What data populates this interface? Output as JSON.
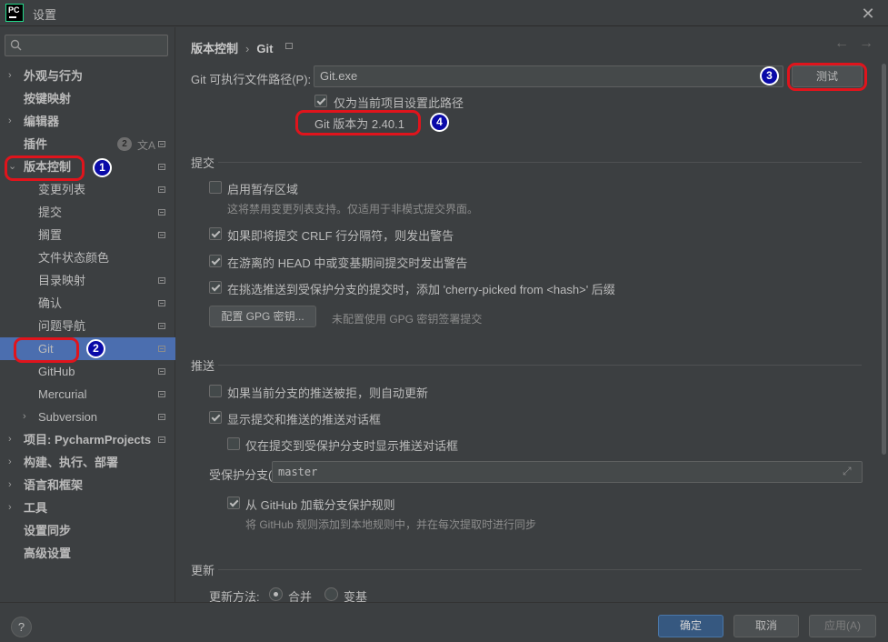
{
  "window": {
    "title": "设置"
  },
  "search": {
    "placeholder": ""
  },
  "sidebar": {
    "items": [
      {
        "label": "外观与行为",
        "arrow": "›"
      },
      {
        "label": "按键映射"
      },
      {
        "label": "编辑器",
        "arrow": "›"
      },
      {
        "label": "插件",
        "badge": "2"
      },
      {
        "label": "版本控制",
        "arrow": "⌄"
      },
      {
        "label": "变更列表"
      },
      {
        "label": "提交"
      },
      {
        "label": "搁置"
      },
      {
        "label": "文件状态颜色"
      },
      {
        "label": "目录映射"
      },
      {
        "label": "确认"
      },
      {
        "label": "问题导航"
      },
      {
        "label": "Git"
      },
      {
        "label": "GitHub"
      },
      {
        "label": "Mercurial"
      },
      {
        "label": "Subversion",
        "arrow": "›"
      },
      {
        "label": "项目: PycharmProjects",
        "arrow": "›"
      },
      {
        "label": "构建、执行、部署",
        "arrow": "›"
      },
      {
        "label": "语言和框架",
        "arrow": "›"
      },
      {
        "label": "工具",
        "arrow": "›"
      },
      {
        "label": "设置同步"
      },
      {
        "label": "高级设置"
      }
    ]
  },
  "breadcrumb": {
    "parent": "版本控制",
    "separator": "›",
    "current": "Git"
  },
  "git_path": {
    "label": "Git 可执行文件路径(P):",
    "value": "Git.exe",
    "test_button": "测试",
    "project_only_label": "仅为当前项目设置此路径",
    "project_only_checked": true,
    "version_text": "Git 版本为 2.40.1"
  },
  "commit": {
    "section": "提交",
    "staging_label": "启用暂存区域",
    "staging_checked": false,
    "staging_hint": "这将禁用变更列表支持。仅适用于非模式提交界面。",
    "crlf_label": "如果即将提交 CRLF 行分隔符，则发出警告",
    "crlf_checked": true,
    "detached_label": "在游离的 HEAD 中或变基期间提交时发出警告",
    "detached_checked": true,
    "cherry_label": "在挑选推送到受保护分支的提交时，添加 'cherry-picked from <hash>' 后缀",
    "cherry_checked": true,
    "gpg_button": "配置 GPG 密钥...",
    "gpg_hint": "未配置使用 GPG 密钥签署提交"
  },
  "push": {
    "section": "推送",
    "auto_update_label": "如果当前分支的推送被拒，则自动更新",
    "auto_update_checked": false,
    "show_dialog_label": "显示提交和推送的推送对话框",
    "show_dialog_checked": true,
    "protected_only_label": "仅在提交到受保护分支时显示推送对话框",
    "protected_only_checked": false,
    "protected_branches_label": "受保护分支(E):",
    "protected_branches_value": "master",
    "github_rules_label": "从 GitHub 加载分支保护规则",
    "github_rules_checked": true,
    "github_rules_hint": "将 GitHub 规则添加到本地规则中，并在每次提取时进行同步"
  },
  "update": {
    "section": "更新",
    "method_label": "更新方法:",
    "merge_label": "合并",
    "rebase_label": "变基",
    "selected": "merge"
  },
  "footer": {
    "ok": "确定",
    "cancel": "取消",
    "apply": "应用(A)",
    "help": "?"
  },
  "annotations": [
    "1",
    "2",
    "3",
    "4"
  ],
  "colors": {
    "accent": "#4b6eaf",
    "annotation_ring": "#e0141c",
    "annotation_badge": "#0a0aa8"
  }
}
